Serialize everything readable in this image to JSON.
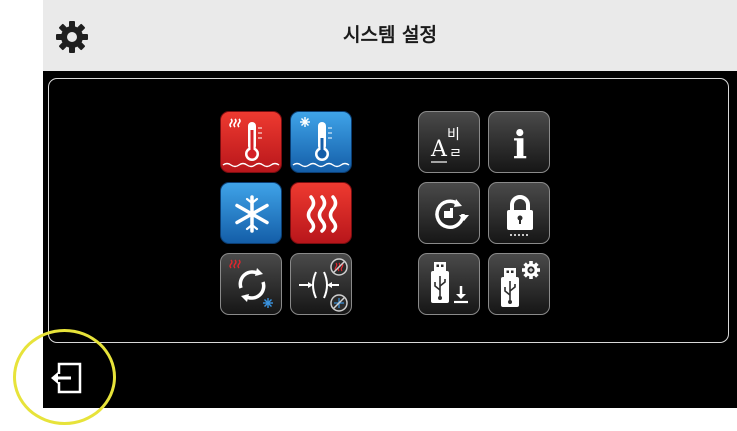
{
  "header": {
    "title": "시스템 설정",
    "settings_icon": "gear-icon"
  },
  "tiles": {
    "left_group": [
      "heating-temperature-icon",
      "cooling-temperature-icon",
      "cooling-mode-icon",
      "heating-mode-icon",
      "heat-cool-changeover-icon",
      "deadband-icon"
    ],
    "right_group": [
      "language-icon",
      "information-icon",
      "factory-reset-icon",
      "lock-icon",
      "usb-download-icon",
      "usb-settings-icon"
    ],
    "language_glyph_latin": "A",
    "language_glyph_korean": "비",
    "language_glyph_korean2": "ㄹ",
    "info_glyph": "i"
  },
  "footer": {
    "back_icon": "exit-icon",
    "highlight_color": "#e7e33a"
  },
  "colors": {
    "red_tile": "#d42026",
    "blue_tile": "#2a7fc9",
    "dark_tile": "#2b2b2b",
    "header_bg": "#eaeaea",
    "screen_bg": "#000000"
  }
}
